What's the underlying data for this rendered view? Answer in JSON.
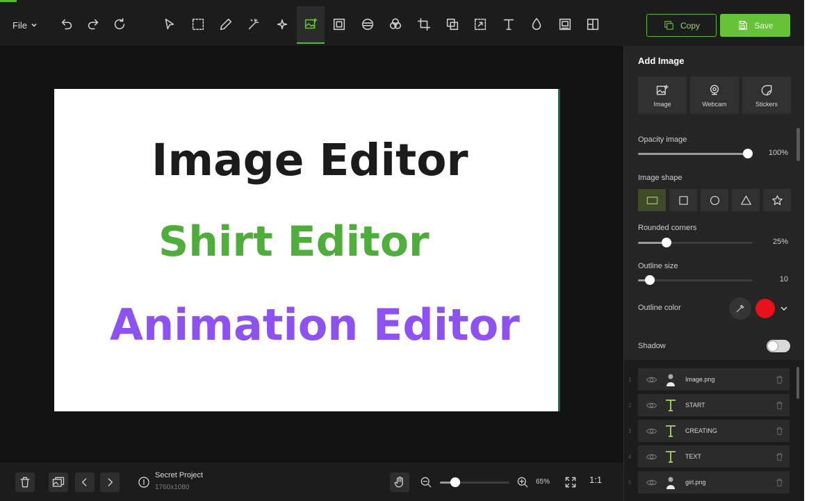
{
  "toolbar": {
    "file_label": "File",
    "copy_label": "Copy",
    "save_label": "Save",
    "accent_color": "#67c23a"
  },
  "canvas": {
    "background": "#ffffff",
    "lines": [
      {
        "text": "Image Editor",
        "color": "#1b1b1b"
      },
      {
        "text": "Shirt Editor",
        "color": "#4fae3b"
      },
      {
        "text": "Animation Editor",
        "color": "#8d52f1"
      }
    ]
  },
  "panel": {
    "title": "Add Image",
    "add_buttons": [
      {
        "label": "Image",
        "icon": "image-plus-icon"
      },
      {
        "label": "Webcam",
        "icon": "webcam-icon"
      },
      {
        "label": "Stickers",
        "icon": "sticker-icon"
      }
    ],
    "opacity": {
      "label": "Opacity image",
      "value_text": "100%",
      "value": 1.0
    },
    "shape": {
      "label": "Image shape",
      "options": [
        "rectangle",
        "square",
        "circle",
        "triangle",
        "star"
      ],
      "selected": "rectangle"
    },
    "rounded": {
      "label": "Rounded corners",
      "value_text": "25%",
      "value": 0.25
    },
    "outline_size": {
      "label": "Outline size",
      "value_text": "10",
      "value": 0.1
    },
    "outline_color": {
      "label": "Outline color",
      "color": "#e8101a"
    },
    "shadow": {
      "label": "Shadow",
      "enabled": false
    }
  },
  "layers": [
    {
      "name": "Image.png",
      "type": "image"
    },
    {
      "name": "START",
      "type": "text"
    },
    {
      "name": "CREATING",
      "type": "text"
    },
    {
      "name": "TEXT",
      "type": "text"
    },
    {
      "name": "girl.png",
      "type": "image"
    }
  ],
  "bottombar": {
    "project_name": "Secret Project",
    "project_size": "1760x1080",
    "zoom_text": "65%",
    "zoom_value": 0.65,
    "ratio_label": "1:1"
  }
}
